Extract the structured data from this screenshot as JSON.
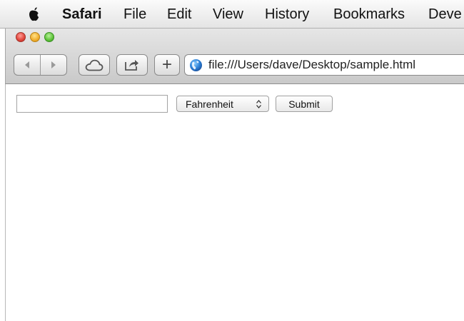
{
  "menubar": {
    "app_name": "Safari",
    "items": [
      "File",
      "Edit",
      "View",
      "History",
      "Bookmarks",
      "Deve"
    ]
  },
  "toolbar": {
    "plus_label": "+",
    "url": "file:///Users/dave/Desktop/sample.html"
  },
  "form": {
    "input_value": "",
    "unit_select": "Fahrenheit",
    "submit_label": "Submit"
  },
  "icons": {
    "apple": "apple-icon",
    "back": "back-arrow-icon",
    "forward": "forward-arrow-icon",
    "icloud": "icloud-icon",
    "share": "share-icon",
    "globe": "globe-icon",
    "select": "updown-chevron-icon"
  }
}
